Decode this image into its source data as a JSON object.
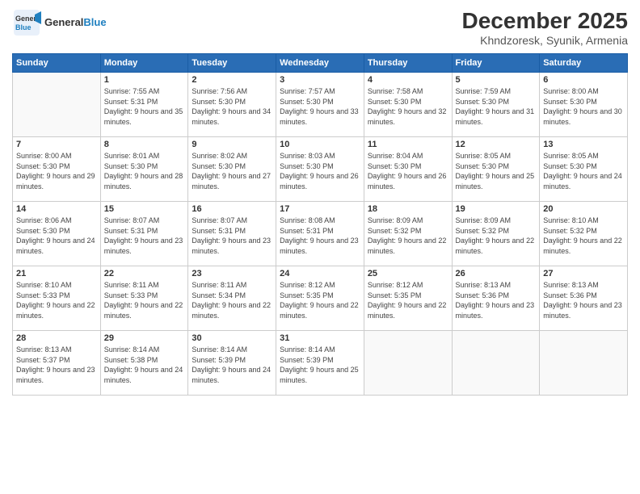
{
  "header": {
    "logo_general": "General",
    "logo_blue": "Blue",
    "title": "December 2025",
    "subtitle": "Khndzoresk, Syunik, Armenia"
  },
  "days_of_week": [
    "Sunday",
    "Monday",
    "Tuesday",
    "Wednesday",
    "Thursday",
    "Friday",
    "Saturday"
  ],
  "weeks": [
    [
      {
        "day": "",
        "info": ""
      },
      {
        "day": "1",
        "info": "Sunrise: 7:55 AM\nSunset: 5:31 PM\nDaylight: 9 hours\nand 35 minutes."
      },
      {
        "day": "2",
        "info": "Sunrise: 7:56 AM\nSunset: 5:30 PM\nDaylight: 9 hours\nand 34 minutes."
      },
      {
        "day": "3",
        "info": "Sunrise: 7:57 AM\nSunset: 5:30 PM\nDaylight: 9 hours\nand 33 minutes."
      },
      {
        "day": "4",
        "info": "Sunrise: 7:58 AM\nSunset: 5:30 PM\nDaylight: 9 hours\nand 32 minutes."
      },
      {
        "day": "5",
        "info": "Sunrise: 7:59 AM\nSunset: 5:30 PM\nDaylight: 9 hours\nand 31 minutes."
      },
      {
        "day": "6",
        "info": "Sunrise: 8:00 AM\nSunset: 5:30 PM\nDaylight: 9 hours\nand 30 minutes."
      }
    ],
    [
      {
        "day": "7",
        "info": ""
      },
      {
        "day": "8",
        "info": "Sunrise: 8:01 AM\nSunset: 5:30 PM\nDaylight: 9 hours\nand 28 minutes."
      },
      {
        "day": "9",
        "info": "Sunrise: 8:02 AM\nSunset: 5:30 PM\nDaylight: 9 hours\nand 27 minutes."
      },
      {
        "day": "10",
        "info": "Sunrise: 8:03 AM\nSunset: 5:30 PM\nDaylight: 9 hours\nand 26 minutes."
      },
      {
        "day": "11",
        "info": "Sunrise: 8:04 AM\nSunset: 5:30 PM\nDaylight: 9 hours\nand 26 minutes."
      },
      {
        "day": "12",
        "info": "Sunrise: 8:05 AM\nSunset: 5:30 PM\nDaylight: 9 hours\nand 25 minutes."
      },
      {
        "day": "13",
        "info": "Sunrise: 8:05 AM\nSunset: 5:30 PM\nDaylight: 9 hours\nand 24 minutes."
      }
    ],
    [
      {
        "day": "14",
        "info": ""
      },
      {
        "day": "15",
        "info": "Sunrise: 8:07 AM\nSunset: 5:31 PM\nDaylight: 9 hours\nand 23 minutes."
      },
      {
        "day": "16",
        "info": "Sunrise: 8:07 AM\nSunset: 5:31 PM\nDaylight: 9 hours\nand 23 minutes."
      },
      {
        "day": "17",
        "info": "Sunrise: 8:08 AM\nSunset: 5:31 PM\nDaylight: 9 hours\nand 23 minutes."
      },
      {
        "day": "18",
        "info": "Sunrise: 8:09 AM\nSunset: 5:32 PM\nDaylight: 9 hours\nand 22 minutes."
      },
      {
        "day": "19",
        "info": "Sunrise: 8:09 AM\nSunset: 5:32 PM\nDaylight: 9 hours\nand 22 minutes."
      },
      {
        "day": "20",
        "info": "Sunrise: 8:10 AM\nSunset: 5:32 PM\nDaylight: 9 hours\nand 22 minutes."
      }
    ],
    [
      {
        "day": "21",
        "info": "Sunrise: 8:10 AM\nSunset: 5:33 PM\nDaylight: 9 hours\nand 22 minutes."
      },
      {
        "day": "22",
        "info": "Sunrise: 8:11 AM\nSunset: 5:33 PM\nDaylight: 9 hours\nand 22 minutes."
      },
      {
        "day": "23",
        "info": "Sunrise: 8:11 AM\nSunset: 5:34 PM\nDaylight: 9 hours\nand 22 minutes."
      },
      {
        "day": "24",
        "info": "Sunrise: 8:12 AM\nSunset: 5:35 PM\nDaylight: 9 hours\nand 22 minutes."
      },
      {
        "day": "25",
        "info": "Sunrise: 8:12 AM\nSunset: 5:35 PM\nDaylight: 9 hours\nand 22 minutes."
      },
      {
        "day": "26",
        "info": "Sunrise: 8:13 AM\nSunset: 5:36 PM\nDaylight: 9 hours\nand 23 minutes."
      },
      {
        "day": "27",
        "info": "Sunrise: 8:13 AM\nSunset: 5:36 PM\nDaylight: 9 hours\nand 23 minutes."
      }
    ],
    [
      {
        "day": "28",
        "info": "Sunrise: 8:13 AM\nSunset: 5:37 PM\nDaylight: 9 hours\nand 23 minutes."
      },
      {
        "day": "29",
        "info": "Sunrise: 8:14 AM\nSunset: 5:38 PM\nDaylight: 9 hours\nand 24 minutes."
      },
      {
        "day": "30",
        "info": "Sunrise: 8:14 AM\nSunset: 5:39 PM\nDaylight: 9 hours\nand 24 minutes."
      },
      {
        "day": "31",
        "info": "Sunrise: 8:14 AM\nSunset: 5:39 PM\nDaylight: 9 hours\nand 25 minutes."
      },
      {
        "day": "",
        "info": ""
      },
      {
        "day": "",
        "info": ""
      },
      {
        "day": "",
        "info": ""
      }
    ]
  ],
  "week7_day7_info": "Sunrise: 8:00 AM\nSunset: 5:30 PM\nDaylight: 9 hours\nand 29 minutes.",
  "week14_info": "Sunrise: 8:06 AM\nSunset: 5:30 PM\nDaylight: 9 hours\nand 24 minutes."
}
